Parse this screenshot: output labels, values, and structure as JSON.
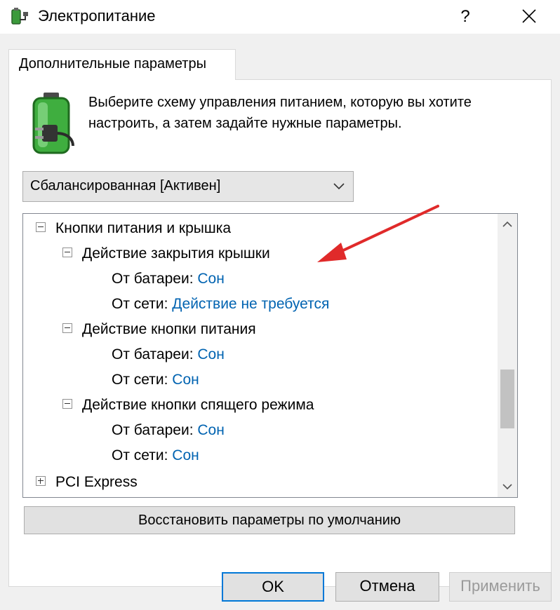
{
  "window": {
    "title": "Электропитание",
    "help_label": "?",
    "icon": "power-options-icon"
  },
  "tab": {
    "label": "Дополнительные параметры"
  },
  "description": "Выберите схему управления питанием, которую вы хотите настроить, а затем задайте нужные параметры.",
  "scheme_select": {
    "value": "Сбалансированная [Активен]"
  },
  "tree": {
    "root": "Кнопки питания и крышка",
    "groups": [
      {
        "label": "Действие закрытия крышки",
        "battery_label": "От батареи:",
        "battery_value": "Сон",
        "plugged_label": "От сети:",
        "plugged_value": "Действие не требуется"
      },
      {
        "label": "Действие кнопки питания",
        "battery_label": "От батареи:",
        "battery_value": "Сон",
        "plugged_label": "От сети:",
        "plugged_value": "Сон"
      },
      {
        "label": "Действие кнопки спящего режима",
        "battery_label": "От батареи:",
        "battery_value": "Сон",
        "plugged_label": "От сети:",
        "plugged_value": "Сон"
      }
    ],
    "next_item": "PCI Express"
  },
  "buttons": {
    "restore": "Восстановить параметры по умолчанию",
    "ok": "OK",
    "cancel": "Отмена",
    "apply": "Применить"
  },
  "colors": {
    "link_value": "#0063b1",
    "annotation_arrow": "#e02a2a",
    "ok_border": "#0078d7"
  }
}
